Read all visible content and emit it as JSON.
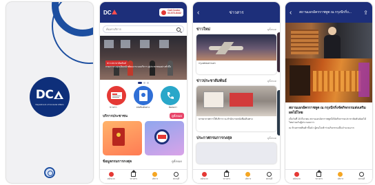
{
  "splash": {
    "logo_text": "DC",
    "logo_subtitle": "Department of Consular Affairs",
    "colors": {
      "navy": "#0e2f7a",
      "accent": "#1d4fa0"
    }
  },
  "home": {
    "logo_text": "DC",
    "call_center": {
      "line1": "Call Center",
      "line2": "02-572-8442"
    },
    "search_placeholder": "ค้นหาบริการ",
    "banner": {
      "badge": "ข่าวประชาสัมพันธ์",
      "caption": "กรมการกงสุลเดินหน้าพัฒนาระบบบริการ สู่ประชาชนอย่างทั่วถึง"
    },
    "quick_items": [
      {
        "label": "ข่าวสาร",
        "icon": "news-icon"
      },
      {
        "label": "หนังสือเดินทาง",
        "icon": "passport-icon"
      },
      {
        "label": "ติดต่อเรา",
        "icon": "phone-icon"
      }
    ],
    "section1": {
      "title": "บริการประชาชน",
      "more": "ดูทั้งหมด"
    },
    "section2": {
      "title": "ข้อมูลกรมการกงสุล",
      "more": "ดูทั้งหมด"
    },
    "tabs": [
      {
        "label": "หน้าแรก",
        "icon": "home-icon"
      },
      {
        "label": "ข่าวสาร",
        "icon": "news-icon"
      },
      {
        "label": "บริการ",
        "icon": "service-icon"
      },
      {
        "label": "สถานที่",
        "icon": "location-icon"
      }
    ]
  },
  "news": {
    "title": "ข่าวสาร",
    "sections": [
      {
        "title": "ข่าวใหม่",
        "more": "ดูทั้งหมด",
        "caption": "กรุงเทพมหานคร"
      },
      {
        "title": "ข่าวประชาสัมพันธ์",
        "more": "ดูทั้งหมด",
        "caption": "บรรยากาศการให้บริการ ณ สำนักงานหนังสือเดินทาง"
      },
      {
        "title": "ประกาศกรมการกงสุล",
        "more": "ดูทั้งหมด",
        "caption": ""
      }
    ],
    "tabs": [
      {
        "label": "หน้าแรก"
      },
      {
        "label": "ข่าวสาร"
      },
      {
        "label": "บริการ"
      },
      {
        "label": "สถานที่"
      }
    ]
  },
  "article": {
    "header_title": "สถานเอกอัครราชทูต ณ กรุงปักกิ่ง...",
    "title": "สถานเอกอัครราชทูต ณ กรุงปักกิ่งจัดกิจกรรมส่งเสริมผลไม้ไทย",
    "body": [
      "เมื่อวันที่ 15 มีนาคม สถานเอกอัครราชทูตได้จัดกิจกรรมประชาสัมพันธ์ผลไม้ไทยร่วมกับผู้ประกอบการ",
      "ณ ห้างสรรพสินค้าชั้นนำ ผู้สนใจเข้าร่วมกิจกรรมเป็นจำนวนมาก"
    ],
    "tabs": [
      {
        "label": "หน้าแรก"
      },
      {
        "label": "ข่าวสาร"
      },
      {
        "label": "บริการ"
      },
      {
        "label": "สถานที่"
      }
    ]
  }
}
